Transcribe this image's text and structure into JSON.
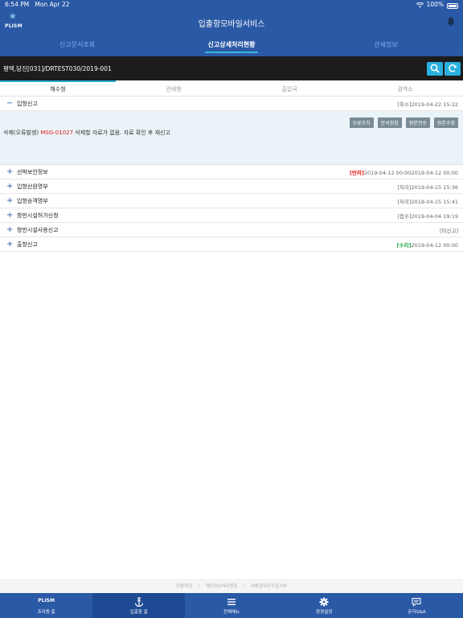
{
  "status_bar": {
    "time": "6:54 PM",
    "date": "Mon Apr 22",
    "battery": "100%"
  },
  "header": {
    "logo_text": "PLISM",
    "title": "입출항모바일서비스"
  },
  "nav_tabs": [
    {
      "label": "신고문서조회"
    },
    {
      "label": "신고상세처리현황"
    },
    {
      "label": "관세정보"
    }
  ],
  "search": {
    "value": "평택,당진[031]/DRTEST030/2019-001"
  },
  "progress": {
    "fraction": 0.25
  },
  "org_tabs": [
    {
      "label": "해수청"
    },
    {
      "label": "관세청"
    },
    {
      "label": "출입국"
    },
    {
      "label": "검역소"
    }
  ],
  "items": [
    {
      "sign": "−",
      "label": "입항신고",
      "status": "[취소]",
      "date": "2019-04-22 15:22"
    },
    {
      "sign": "+",
      "label": "선박보안정보",
      "status": "[반려]",
      "date": "2019-04-12 00:002019-04-12 00:00"
    },
    {
      "sign": "+",
      "label": "입항선원명부",
      "status": "[처리]",
      "date": "2019-04-15 15:36"
    },
    {
      "sign": "+",
      "label": "입항승객명부",
      "status": "[처리]",
      "date": "2019-04-15 15:41"
    },
    {
      "sign": "+",
      "label": "항만시설허가신청",
      "status": "[접수]",
      "date": "2019-04-04 19:19"
    },
    {
      "sign": "+",
      "label": "항만시설사용신고",
      "status": "[미신고]",
      "date": ""
    },
    {
      "sign": "+",
      "label": "출항신고",
      "status": "[수리]",
      "date": "2019-04-12 00:00"
    }
  ],
  "detail": {
    "buttons": [
      "오류조치",
      "문서정정",
      "원본전송",
      "원본수정"
    ],
    "message_prefix": "삭제(오류발생)",
    "message_code": "MSG-01027",
    "message_text": "삭제할 자료가 없음. 자료 확인 후 재신고"
  },
  "footer_links": [
    "이용약관",
    "개인정보처리방침",
    "이메일무단수집거부"
  ],
  "bottom_nav": [
    {
      "icon": "plism-logo",
      "top": "PLISM",
      "label": "프리즘 홈"
    },
    {
      "icon": "anchor-icon",
      "label": "입출항 홈"
    },
    {
      "icon": "menu-icon",
      "label": "전체메뉴"
    },
    {
      "icon": "gear-icon",
      "label": "환경설정"
    },
    {
      "icon": "chat-icon",
      "label": "공지Q&A"
    }
  ],
  "colors": {
    "primary": "#2a59a6",
    "accent": "#2ab0df",
    "error": "#e01c1c",
    "success": "#25a84b"
  }
}
